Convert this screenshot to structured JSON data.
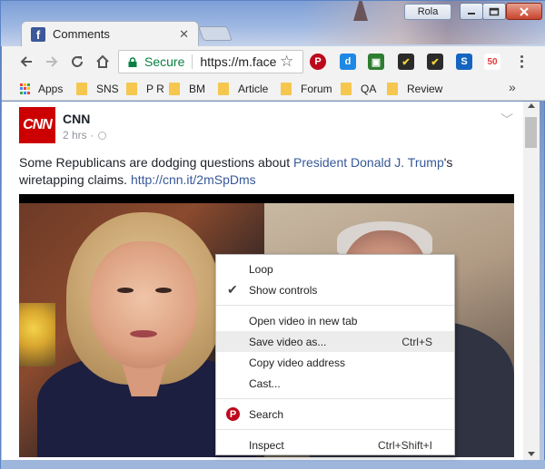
{
  "window": {
    "profile_name": "Rola",
    "tab_title": "Comments",
    "tab_favicon": "facebook-icon"
  },
  "toolbar": {
    "secure_label": "Secure",
    "url": "https://m.face",
    "extensions": [
      "pinterest-icon",
      "d-extension-icon",
      "green-extension-icon",
      "checkmark-extension-icon",
      "checkmark-extension-icon-2",
      "s-extension-icon",
      "50-extension-icon"
    ]
  },
  "bookmarks": [
    {
      "label": "Apps",
      "icon": "apps-grid-icon"
    },
    {
      "label": "SNS",
      "icon": "folder-icon"
    },
    {
      "label": "P R",
      "icon": "folder-icon"
    },
    {
      "label": "BM",
      "icon": "folder-icon"
    },
    {
      "label": "Article",
      "icon": "folder-icon"
    },
    {
      "label": "Forum",
      "icon": "folder-icon"
    },
    {
      "label": "QA",
      "icon": "folder-icon"
    },
    {
      "label": "Review",
      "icon": "folder-icon"
    }
  ],
  "post": {
    "logo_text": "CNN",
    "page_name": "CNN",
    "time": "2 hrs ·",
    "text_before": "Some Republicans are dodging questions about ",
    "mention": "President Donald J. Trump",
    "text_after": "'s wiretapping claims. ",
    "link": "http://cnn.it/2mSpDms"
  },
  "context_menu": {
    "items": [
      {
        "label": "Loop",
        "shortcut": ""
      },
      {
        "label": "Show controls",
        "shortcut": "",
        "checked": true
      },
      {
        "label": "Open video in new tab",
        "shortcut": ""
      },
      {
        "label": "Save video as...",
        "shortcut": "Ctrl+S"
      },
      {
        "label": "Copy video address",
        "shortcut": ""
      },
      {
        "label": "Cast...",
        "shortcut": ""
      },
      {
        "label": "Search",
        "shortcut": ""
      },
      {
        "label": "Inspect",
        "shortcut": "Ctrl+Shift+I"
      }
    ]
  },
  "colors": {
    "accent_link": "#365899",
    "cnn_red": "#cc0000",
    "secure_green": "#0b8043",
    "pinterest_red": "#bd081c"
  }
}
